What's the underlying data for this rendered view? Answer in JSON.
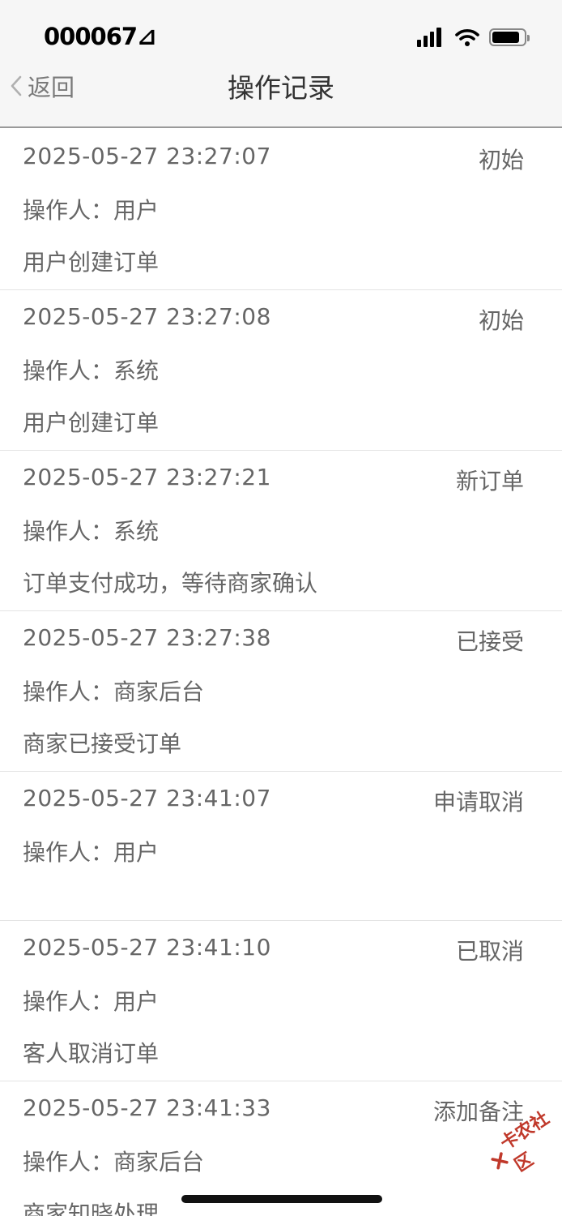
{
  "status_bar": {
    "time": "000067⊿"
  },
  "nav": {
    "back_label": "返回",
    "title": "操作记录"
  },
  "records": [
    {
      "time": "2025-05-27 23:27:07",
      "status": "初始",
      "operator": "操作人：用户",
      "description": "用户创建订单"
    },
    {
      "time": "2025-05-27 23:27:08",
      "status": "初始",
      "operator": "操作人：系统",
      "description": "用户创建订单"
    },
    {
      "time": "2025-05-27 23:27:21",
      "status": "新订单",
      "operator": "操作人：系统",
      "description": "订单支付成功，等待商家确认"
    },
    {
      "time": "2025-05-27 23:27:38",
      "status": "已接受",
      "operator": "操作人：商家后台",
      "description": "商家已接受订单"
    },
    {
      "time": "2025-05-27 23:41:07",
      "status": "申请取消",
      "operator": "操作人：用户",
      "description": ""
    },
    {
      "time": "2025-05-27 23:41:10",
      "status": "已取消",
      "operator": "操作人：用户",
      "description": "客人取消订单"
    },
    {
      "time": "2025-05-27 23:41:33",
      "status": "添加备注",
      "operator": "操作人：商家后台",
      "description": "商家知晓处理"
    }
  ],
  "watermark": {
    "text": "卡农社区"
  },
  "colors": {
    "header_bg": "#f6f6f6",
    "text_secondary": "#666666",
    "watermark_red": "#c0392b"
  }
}
